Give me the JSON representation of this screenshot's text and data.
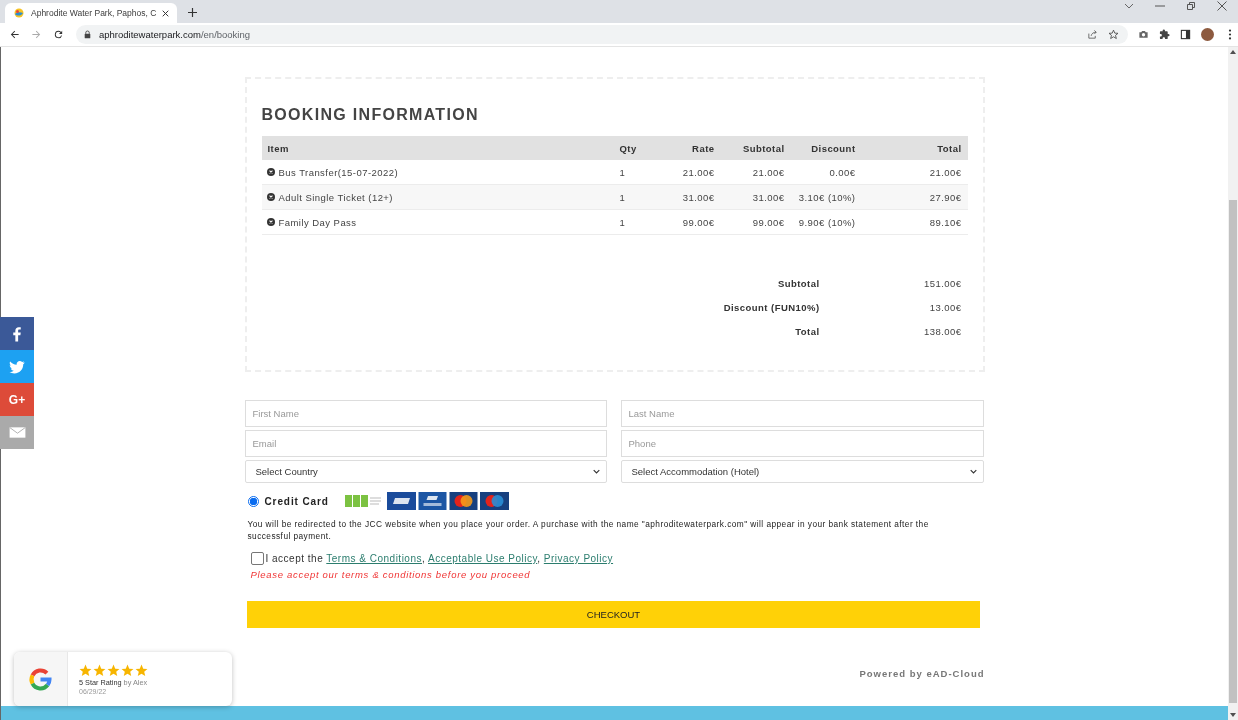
{
  "browser": {
    "tabs": [
      {
        "title": "Aphrodite Water Park, Paphos, C",
        "selected": true
      }
    ],
    "nav_buttons": [
      {
        "kind": "back",
        "disabled": false
      },
      {
        "kind": "forward",
        "disabled": true
      },
      {
        "kind": "reload",
        "disabled": false
      }
    ],
    "url": {
      "host": "aphroditewaterpark.com",
      "path": "/en/booking"
    }
  },
  "social": [
    {
      "kind": "facebook"
    },
    {
      "kind": "twitter"
    },
    {
      "kind": "google_plus",
      "label": "G+"
    },
    {
      "kind": "email"
    }
  ],
  "booking": {
    "title": "BOOKING INFORMATION",
    "columns": [
      "Item",
      "Qty",
      "Rate",
      "Subtotal",
      "Discount",
      "Total"
    ],
    "rows": [
      {
        "item": "Bus Transfer(15-07-2022)",
        "qty": "1",
        "rate": "21.00€",
        "subtotal": "21.00€",
        "discount": "0.00€",
        "total": "21.00€"
      },
      {
        "item": "Adult Single Ticket (12+)",
        "qty": "1",
        "rate": "31.00€",
        "subtotal": "31.00€",
        "discount": "3.10€ (10%)",
        "total": "27.90€"
      },
      {
        "item": "Family Day Pass",
        "qty": "1",
        "rate": "99.00€",
        "subtotal": "99.00€",
        "discount": "9.90€ (10%)",
        "total": "89.10€"
      }
    ],
    "summary": [
      {
        "label": "Subtotal",
        "value": "151.00€"
      },
      {
        "label": "Discount (FUN10%)",
        "value": "13.00€"
      },
      {
        "label": "Total",
        "value": "138.00€"
      }
    ]
  },
  "form": {
    "fields": [
      {
        "kind": "input",
        "placeholder": "First Name"
      },
      {
        "kind": "input",
        "placeholder": "Last Name"
      },
      {
        "kind": "input",
        "placeholder": "Email"
      },
      {
        "kind": "input",
        "placeholder": "Phone"
      },
      {
        "kind": "select",
        "value": "Select Country"
      },
      {
        "kind": "select",
        "value": "Select Accommodation (Hotel)"
      }
    ],
    "payment_methods": [
      {
        "label": "Credit Card",
        "selected": true
      }
    ],
    "notice": "You will be redirected to the JCC website when you place your order. A purchase with the name \"aphroditewaterpark.com\" will appear in your bank statement after the successful payment.",
    "terms": {
      "checked": false,
      "prefix": "I accept the",
      "links": [
        {
          "text": "Terms & Conditions",
          "after": ","
        },
        {
          "text": "Acceptable Use Policy",
          "after": ","
        },
        {
          "text": "Privacy Policy"
        }
      ]
    },
    "error": "Please accept our terms & conditions before you proceed",
    "checkout": "CHECKOUT"
  },
  "footer": {
    "powered_by": "Powered by eAD-Cloud"
  },
  "review": {
    "stars": 5,
    "text": "**5 Star Rating** by Alex",
    "date": "06/29/22"
  }
}
